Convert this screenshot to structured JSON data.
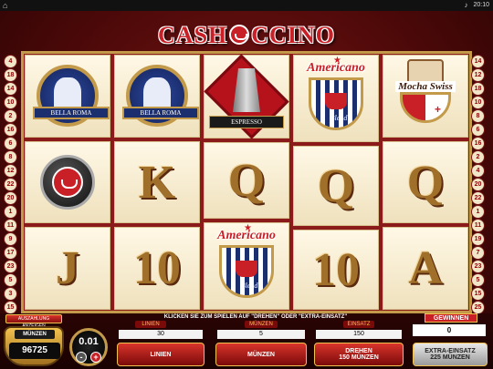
{
  "topbar": {
    "clock": "20:10"
  },
  "title": {
    "part1": "CASH",
    "part2": "CCINO"
  },
  "paylines": {
    "left": [
      "4",
      "18",
      "14",
      "10",
      "2",
      "16",
      "6",
      "8",
      "12",
      "22",
      "20",
      "1",
      "11",
      "9",
      "17",
      "23",
      "5",
      "3",
      "15",
      "24",
      "19",
      "7",
      "25",
      "13"
    ],
    "right": [
      "14",
      "12",
      "18",
      "10",
      "8",
      "6",
      "16",
      "2",
      "4",
      "20",
      "22",
      "1",
      "11",
      "19",
      "7",
      "23",
      "5",
      "15",
      "25",
      "3",
      "13",
      "17",
      "21",
      "9"
    ]
  },
  "reels": [
    [
      {
        "type": "badge",
        "label": "BELLA ROMA"
      },
      {
        "type": "scatter"
      },
      {
        "type": "card",
        "label": "J"
      }
    ],
    [
      {
        "type": "badge",
        "label": "BELLA ROMA"
      },
      {
        "type": "card",
        "label": "K"
      },
      {
        "type": "card",
        "label": "10"
      }
    ],
    [
      {
        "type": "pot",
        "label": "ESPRESSO"
      },
      {
        "type": "card",
        "label": "Q"
      },
      {
        "type": "americano",
        "title": "Americano",
        "sub": "Blend"
      }
    ],
    [
      {
        "type": "americano",
        "title": "Americano",
        "sub": "Blend"
      },
      {
        "type": "card",
        "label": "Q"
      },
      {
        "type": "card",
        "label": "10"
      }
    ],
    [
      {
        "type": "mocha",
        "title": "Mocha Swiss"
      },
      {
        "type": "card",
        "label": "Q"
      },
      {
        "type": "card",
        "label": "A"
      }
    ]
  ],
  "controls": {
    "help_message": "KLICKEN SIE ZUM SPIELEN AUF \"DREHEN\" ODER \"EXTRA-EINSATZ\"",
    "win_pane_button": "AUSZAHLUNG ANZEIGEN",
    "coins_title": "MÜNZEN",
    "coins_value": "96725",
    "coin_size": "0.01",
    "coin_minus": "-",
    "coin_plus": "+",
    "lines_label": "LINIEN",
    "lines_value": "30",
    "lines_button": "LINIEN",
    "coins_label": "MÜNZEN",
    "coins_per_line": "5",
    "coins_button": "MÜNZEN",
    "bet_label": "EINSATZ",
    "bet_value": "150",
    "spin_button": "DREHEN",
    "spin_sub": "150 MÜNZEN",
    "extra_button": "EXTRA-EINSATZ",
    "extra_sub": "225 MÜNZEN",
    "wins_label": "GEWINNEN",
    "wins_value": "0"
  },
  "colors": {
    "accent": "#c91f26",
    "gold": "#c29a4a",
    "background": "#4a0808"
  }
}
